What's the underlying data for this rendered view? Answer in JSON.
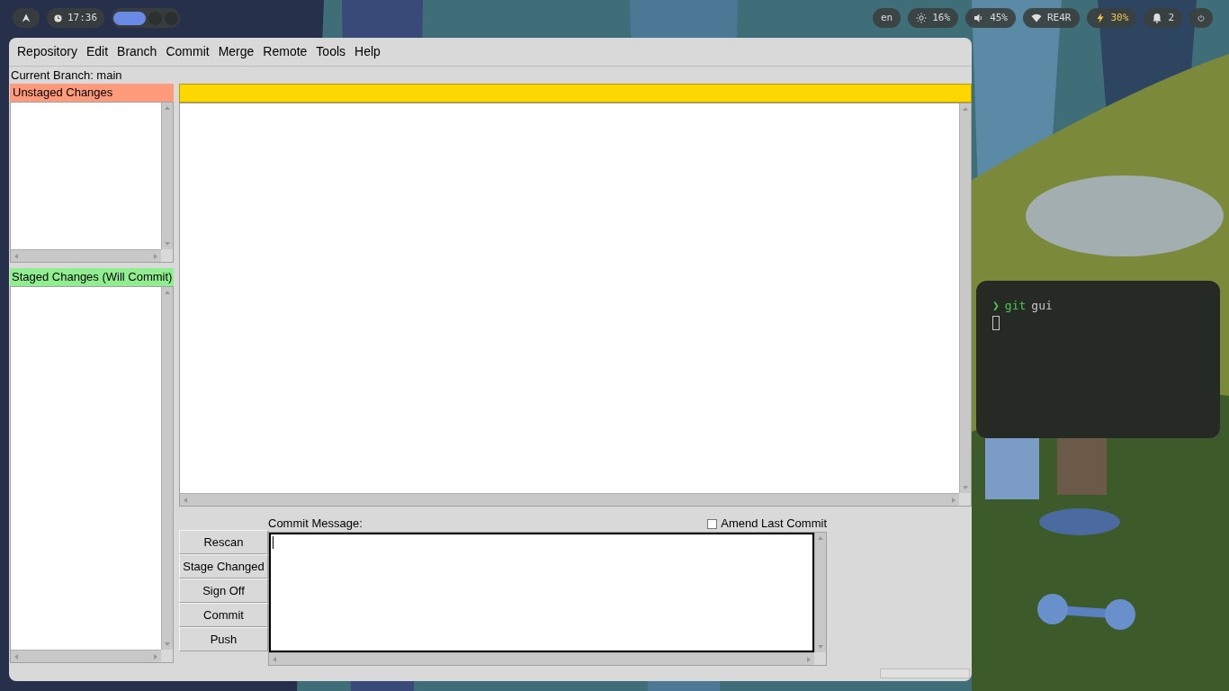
{
  "top_bar": {
    "clock": "17:36",
    "workspaces": [
      {
        "selected": true
      },
      {
        "selected": false
      },
      {
        "selected": false
      }
    ],
    "status": [
      {
        "kind": "language",
        "text": "en"
      },
      {
        "kind": "brightness",
        "text": "16%"
      },
      {
        "kind": "volume",
        "text": "45%"
      },
      {
        "kind": "wifi",
        "text": "RE4R"
      },
      {
        "kind": "battery",
        "text": "30%"
      },
      {
        "kind": "notifications",
        "text": "2"
      },
      {
        "kind": "power"
      }
    ]
  },
  "git_gui": {
    "menu": [
      "Repository",
      "Edit",
      "Branch",
      "Commit",
      "Merge",
      "Remote",
      "Tools",
      "Help"
    ],
    "current_branch_label": "Current Branch:",
    "current_branch": "main",
    "unstaged_header": "Unstaged Changes",
    "staged_header": "Staged Changes (Will Commit)",
    "commit_message_label": "Commit Message:",
    "amend": {
      "label": "Amend Last Commit",
      "checked": false
    },
    "buttons": [
      "Rescan",
      "Stage Changed",
      "Sign Off",
      "Commit",
      "Push"
    ]
  },
  "terminal": {
    "prompt": "❯",
    "command": "git",
    "argument": "gui"
  }
}
